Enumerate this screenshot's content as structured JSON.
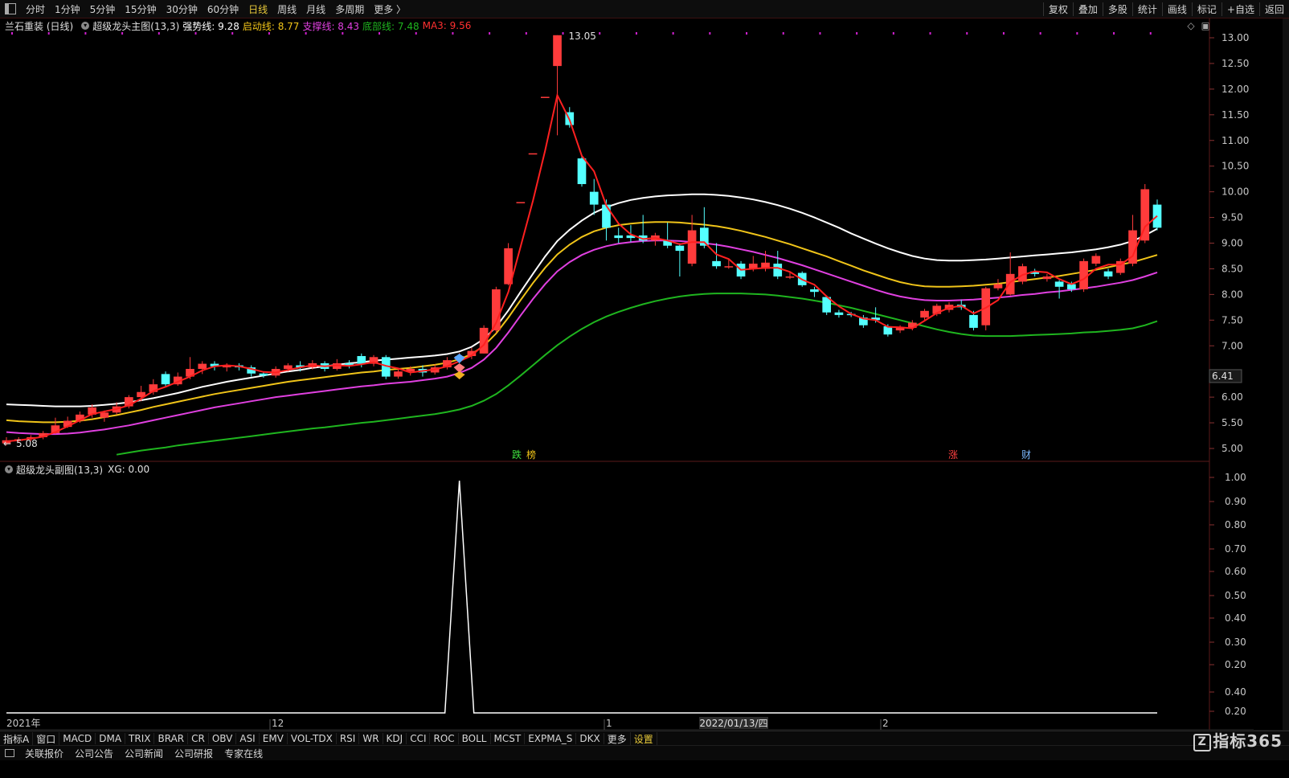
{
  "topbar": {
    "periods": [
      "分时",
      "1分钟",
      "5分钟",
      "15分钟",
      "30分钟",
      "60分钟",
      "日线",
      "周线",
      "月线",
      "多周期",
      "更多 〉"
    ],
    "active": "日线",
    "right": [
      "复权",
      "叠加",
      "多股",
      "统计",
      "画线",
      "标记",
      "+自选",
      "返回"
    ]
  },
  "header": {
    "stock": "兰石重装 (日线)",
    "indicator": "超级龙头主图(13,3)",
    "l1": "强势线: 9.28",
    "l2": "启动线: 8.77",
    "l3": "支撑线: 8.43",
    "l4": "底部线: 7.48",
    "l5": "MA3: 9.56"
  },
  "sub_header": {
    "name": "超级龙头副图(13,3)",
    "xg": "XG: 0.00"
  },
  "price_axis": [
    "13.00",
    "12.50",
    "12.00",
    "11.50",
    "11.00",
    "10.50",
    "10.00",
    "9.50",
    "9.00",
    "8.50",
    "8.00",
    "7.50",
    "7.00",
    "6.41",
    "6.00",
    "5.50",
    "5.00"
  ],
  "price_marker": "6.41",
  "sub_axis": [
    "1.00",
    "0.90",
    "0.80",
    "0.70",
    "0.60",
    "0.50",
    "0.40",
    "0.30",
    "0.20",
    "0.40",
    "0.20"
  ],
  "annotations": {
    "high": "13.05",
    "low": "5.08",
    "die": "跌",
    "bang": "榜",
    "zhang": "涨",
    "cai": "财"
  },
  "date_axis": {
    "y2021": "2021年",
    "m12": "12",
    "m1": "1",
    "cursor": "2022/01/13/四",
    "m2": "2"
  },
  "indicators": [
    "指标A",
    "窗口",
    "MACD",
    "DMA",
    "TRIX",
    "BRAR",
    "CR",
    "OBV",
    "ASI",
    "EMV",
    "VOL-TDX",
    "RSI",
    "WR",
    "KDJ",
    "CCI",
    "ROC",
    "BOLL",
    "MCST",
    "EXPMA_S",
    "DKX",
    "更多",
    "设置"
  ],
  "info_tabs": [
    "关联报价",
    "公司公告",
    "公司新闻",
    "公司研报",
    "专家在线"
  ],
  "logo": "指标365",
  "colors": {
    "up": "#ff3b3b",
    "down": "#54ffff",
    "white": "#ffffff",
    "yellow": "#f0c419",
    "magenta": "#e040e0",
    "green": "#1fb51f",
    "ma": "#ff2020"
  },
  "chart_data": {
    "type": "candlestick",
    "ylim": [
      4.85,
      13.15
    ],
    "candles": [
      [
        5.1,
        5.16,
        5.22,
        5.06
      ],
      [
        5.15,
        5.18,
        5.22,
        5.12
      ],
      [
        5.18,
        5.22,
        5.26,
        5.14
      ],
      [
        5.22,
        5.3,
        5.34,
        5.18
      ],
      [
        5.3,
        5.45,
        5.6,
        5.28
      ],
      [
        5.42,
        5.54,
        5.62,
        5.4
      ],
      [
        5.54,
        5.66,
        5.72,
        5.5
      ],
      [
        5.66,
        5.8,
        5.86,
        5.6
      ],
      [
        5.6,
        5.7,
        5.74,
        5.52
      ],
      [
        5.7,
        5.82,
        5.9,
        5.66
      ],
      [
        5.82,
        6.0,
        6.04,
        5.78
      ],
      [
        6.0,
        6.1,
        6.22,
        5.92
      ],
      [
        6.1,
        6.25,
        6.35,
        6.05
      ],
      [
        6.45,
        6.25,
        6.5,
        6.2
      ],
      [
        6.25,
        6.4,
        6.48,
        6.22
      ],
      [
        6.4,
        6.55,
        6.78,
        6.35
      ],
      [
        6.55,
        6.65,
        6.7,
        6.45
      ],
      [
        6.65,
        6.6,
        6.7,
        6.52
      ],
      [
        6.58,
        6.62,
        6.66,
        6.5
      ],
      [
        6.62,
        6.58,
        6.66,
        6.52
      ],
      [
        6.58,
        6.46,
        6.62,
        6.4
      ],
      [
        6.46,
        6.42,
        6.5,
        6.38
      ],
      [
        6.42,
        6.55,
        6.6,
        6.38
      ],
      [
        6.55,
        6.62,
        6.66,
        6.5
      ],
      [
        6.62,
        6.58,
        6.7,
        6.5
      ],
      [
        6.58,
        6.66,
        6.72,
        6.54
      ],
      [
        6.66,
        6.55,
        6.7,
        6.5
      ],
      [
        6.55,
        6.66,
        6.74,
        6.52
      ],
      [
        6.66,
        6.62,
        6.72,
        6.56
      ],
      [
        6.8,
        6.65,
        6.85,
        6.58
      ],
      [
        6.65,
        6.78,
        6.82,
        6.6
      ],
      [
        6.78,
        6.4,
        6.82,
        6.35
      ],
      [
        6.4,
        6.5,
        6.56,
        6.36
      ],
      [
        6.5,
        6.55,
        6.6,
        6.42
      ],
      [
        6.55,
        6.48,
        6.62,
        6.4
      ],
      [
        6.48,
        6.58,
        6.64,
        6.44
      ],
      [
        6.58,
        6.72,
        6.78,
        6.54
      ],
      [
        6.72,
        6.8,
        6.86,
        6.68
      ],
      [
        6.8,
        6.9,
        6.96,
        6.74
      ],
      [
        6.85,
        7.35,
        7.4,
        6.85
      ],
      [
        7.3,
        8.1,
        8.15,
        7.25
      ],
      [
        8.2,
        8.9,
        9.0,
        8.18
      ],
      [
        9.8,
        9.8,
        9.8,
        9.8
      ],
      [
        10.75,
        10.75,
        10.75,
        10.75
      ],
      [
        11.85,
        11.85,
        11.85,
        11.85
      ],
      [
        12.45,
        13.05,
        13.05,
        11.1
      ],
      [
        11.55,
        11.3,
        11.65,
        11.25
      ],
      [
        10.65,
        10.15,
        10.7,
        10.1
      ],
      [
        10.0,
        9.75,
        10.25,
        9.55
      ],
      [
        9.75,
        9.3,
        9.85,
        9.05
      ],
      [
        9.15,
        9.1,
        9.3,
        9.0
      ],
      [
        9.15,
        9.1,
        9.35,
        9.02
      ],
      [
        9.15,
        9.05,
        9.55,
        9.0
      ],
      [
        9.05,
        9.15,
        9.2,
        8.95
      ],
      [
        9.05,
        8.95,
        9.4,
        8.9
      ],
      [
        8.95,
        8.85,
        9.0,
        8.35
      ],
      [
        8.6,
        9.25,
        9.55,
        8.55
      ],
      [
        9.3,
        8.95,
        9.7,
        8.9
      ],
      [
        8.65,
        8.55,
        9.0,
        8.5
      ],
      [
        8.55,
        8.55,
        8.7,
        8.5
      ],
      [
        8.6,
        8.35,
        8.65,
        8.3
      ],
      [
        8.5,
        8.6,
        8.75,
        8.45
      ],
      [
        8.5,
        8.62,
        8.85,
        8.45
      ],
      [
        8.6,
        8.35,
        8.85,
        8.3
      ],
      [
        8.35,
        8.35,
        8.45,
        8.3
      ],
      [
        8.42,
        8.18,
        8.45,
        8.15
      ],
      [
        8.1,
        8.05,
        8.15,
        7.95
      ],
      [
        7.95,
        7.65,
        7.98,
        7.6
      ],
      [
        7.65,
        7.6,
        7.7,
        7.55
      ],
      [
        7.62,
        7.6,
        7.66,
        7.56
      ],
      [
        7.55,
        7.4,
        7.6,
        7.35
      ],
      [
        7.55,
        7.5,
        7.75,
        7.45
      ],
      [
        7.38,
        7.22,
        7.42,
        7.18
      ],
      [
        7.3,
        7.35,
        7.4,
        7.25
      ],
      [
        7.35,
        7.45,
        7.5,
        7.3
      ],
      [
        7.55,
        7.68,
        7.72,
        7.5
      ],
      [
        7.62,
        7.78,
        7.82,
        7.58
      ],
      [
        7.7,
        7.8,
        7.85,
        7.65
      ],
      [
        7.8,
        7.75,
        7.9,
        7.7
      ],
      [
        7.6,
        7.35,
        7.68,
        7.3
      ],
      [
        7.4,
        8.12,
        8.15,
        7.3
      ],
      [
        8.12,
        8.2,
        8.3,
        8.08
      ],
      [
        8.0,
        8.4,
        8.82,
        7.98
      ],
      [
        8.25,
        8.55,
        8.6,
        8.2
      ],
      [
        8.45,
        8.4,
        8.5,
        8.35
      ],
      [
        8.3,
        8.35,
        8.4,
        8.25
      ],
      [
        8.25,
        8.15,
        8.28,
        7.92
      ],
      [
        8.2,
        8.1,
        8.25,
        8.05
      ],
      [
        8.1,
        8.65,
        8.7,
        8.05
      ],
      [
        8.6,
        8.75,
        8.8,
        8.55
      ],
      [
        8.45,
        8.35,
        8.5,
        8.3
      ],
      [
        8.42,
        8.65,
        8.7,
        8.38
      ],
      [
        8.6,
        9.25,
        9.55,
        8.55
      ],
      [
        9.05,
        10.05,
        10.15,
        9.0
      ],
      [
        9.75,
        9.3,
        9.85,
        9.25
      ]
    ],
    "ma3": [
      5.14,
      5.16,
      5.19,
      5.23,
      5.32,
      5.43,
      5.55,
      5.67,
      5.72,
      5.77,
      5.84,
      5.97,
      6.12,
      6.2,
      6.3,
      6.4,
      6.52,
      6.6,
      6.62,
      6.6,
      6.55,
      6.49,
      6.48,
      6.53,
      6.58,
      6.62,
      6.6,
      6.62,
      6.61,
      6.64,
      6.68,
      6.61,
      6.56,
      6.48,
      6.51,
      6.54,
      6.6,
      6.7,
      6.81,
      7.02,
      7.45,
      8.05,
      8.93,
      9.82,
      10.8,
      11.88,
      11.4,
      10.7,
      10.4,
      9.73,
      9.38,
      9.17,
      9.08,
      9.1,
      9.05,
      8.98,
      9.02,
      9.02,
      8.78,
      8.69,
      8.48,
      8.5,
      8.52,
      8.52,
      8.44,
      8.29,
      8.19,
      7.96,
      7.77,
      7.62,
      7.53,
      7.5,
      7.37,
      7.36,
      7.34,
      7.49,
      7.64,
      7.74,
      7.78,
      7.63,
      7.74,
      7.89,
      8.24,
      8.38,
      8.45,
      8.43,
      8.3,
      8.2,
      8.3,
      8.5,
      8.58,
      8.58,
      8.75,
      9.32,
      9.53
    ],
    "strong": [
      5.86,
      5.85,
      5.84,
      5.83,
      5.82,
      5.82,
      5.82,
      5.83,
      5.85,
      5.87,
      5.9,
      5.94,
      5.98,
      6.03,
      6.08,
      6.14,
      6.2,
      6.25,
      6.3,
      6.34,
      6.38,
      6.42,
      6.46,
      6.5,
      6.53,
      6.57,
      6.6,
      6.63,
      6.66,
      6.68,
      6.71,
      6.73,
      6.75,
      6.77,
      6.79,
      6.81,
      6.84,
      6.89,
      6.98,
      7.13,
      7.37,
      7.69,
      8.05,
      8.4,
      8.74,
      9.04,
      9.26,
      9.44,
      9.59,
      9.7,
      9.78,
      9.84,
      9.88,
      9.91,
      9.93,
      9.94,
      9.95,
      9.95,
      9.94,
      9.92,
      9.89,
      9.85,
      9.8,
      9.74,
      9.67,
      9.59,
      9.5,
      9.4,
      9.3,
      9.19,
      9.09,
      8.99,
      8.9,
      8.82,
      8.75,
      8.7,
      8.67,
      8.66,
      8.66,
      8.67,
      8.68,
      8.7,
      8.72,
      8.74,
      8.76,
      8.78,
      8.8,
      8.82,
      8.85,
      8.88,
      8.92,
      8.97,
      9.04,
      9.15,
      9.28
    ],
    "start": [
      5.55,
      5.53,
      5.52,
      5.51,
      5.51,
      5.52,
      5.54,
      5.57,
      5.61,
      5.65,
      5.7,
      5.75,
      5.81,
      5.86,
      5.91,
      5.96,
      6.01,
      6.06,
      6.1,
      6.14,
      6.18,
      6.22,
      6.26,
      6.3,
      6.33,
      6.36,
      6.39,
      6.42,
      6.45,
      6.48,
      6.5,
      6.53,
      6.55,
      6.57,
      6.6,
      6.63,
      6.67,
      6.74,
      6.84,
      7.0,
      7.24,
      7.55,
      7.89,
      8.22,
      8.52,
      8.78,
      8.97,
      9.12,
      9.23,
      9.3,
      9.35,
      9.38,
      9.4,
      9.41,
      9.41,
      9.4,
      9.38,
      9.36,
      9.33,
      9.29,
      9.24,
      9.18,
      9.12,
      9.05,
      8.98,
      8.9,
      8.82,
      8.74,
      8.65,
      8.56,
      8.47,
      8.39,
      8.31,
      8.24,
      8.19,
      8.16,
      8.15,
      8.15,
      8.16,
      8.17,
      8.19,
      8.21,
      8.24,
      8.27,
      8.3,
      8.33,
      8.36,
      8.4,
      8.44,
      8.48,
      8.53,
      8.58,
      8.63,
      8.7,
      8.77
    ],
    "support": [
      5.32,
      5.3,
      5.29,
      5.28,
      5.28,
      5.29,
      5.31,
      5.34,
      5.37,
      5.41,
      5.45,
      5.5,
      5.55,
      5.6,
      5.65,
      5.7,
      5.75,
      5.8,
      5.84,
      5.88,
      5.92,
      5.96,
      6.0,
      6.03,
      6.06,
      6.09,
      6.12,
      6.15,
      6.18,
      6.21,
      6.23,
      6.26,
      6.28,
      6.3,
      6.33,
      6.36,
      6.4,
      6.47,
      6.57,
      6.73,
      6.96,
      7.26,
      7.59,
      7.91,
      8.2,
      8.45,
      8.63,
      8.77,
      8.87,
      8.94,
      8.99,
      9.02,
      9.04,
      9.05,
      9.05,
      9.04,
      9.02,
      9.0,
      8.97,
      8.93,
      8.88,
      8.83,
      8.77,
      8.71,
      8.64,
      8.57,
      8.49,
      8.41,
      8.33,
      8.25,
      8.17,
      8.09,
      8.02,
      7.96,
      7.92,
      7.89,
      7.88,
      7.88,
      7.89,
      7.9,
      7.92,
      7.94,
      7.96,
      7.99,
      8.01,
      8.04,
      8.06,
      8.09,
      8.12,
      8.15,
      8.19,
      8.23,
      8.28,
      8.35,
      8.43
    ],
    "bottom": [
      4.6,
      4.62,
      4.64,
      4.67,
      4.7,
      4.73,
      4.76,
      4.8,
      4.84,
      4.88,
      4.92,
      4.96,
      4.99,
      5.02,
      5.06,
      5.09,
      5.12,
      5.15,
      5.18,
      5.21,
      5.24,
      5.27,
      5.3,
      5.33,
      5.36,
      5.39,
      5.41,
      5.44,
      5.47,
      5.5,
      5.52,
      5.55,
      5.58,
      5.61,
      5.64,
      5.67,
      5.71,
      5.76,
      5.83,
      5.93,
      6.06,
      6.23,
      6.42,
      6.62,
      6.82,
      7.01,
      7.18,
      7.33,
      7.46,
      7.57,
      7.66,
      7.74,
      7.81,
      7.87,
      7.92,
      7.96,
      7.99,
      8.01,
      8.02,
      8.02,
      8.02,
      8.01,
      8.0,
      7.98,
      7.95,
      7.92,
      7.88,
      7.84,
      7.79,
      7.74,
      7.68,
      7.62,
      7.56,
      7.5,
      7.44,
      7.38,
      7.32,
      7.27,
      7.23,
      7.2,
      7.19,
      7.19,
      7.19,
      7.2,
      7.21,
      7.22,
      7.23,
      7.24,
      7.26,
      7.27,
      7.29,
      7.31,
      7.34,
      7.4,
      7.48
    ],
    "xg_spike_index": 37
  }
}
